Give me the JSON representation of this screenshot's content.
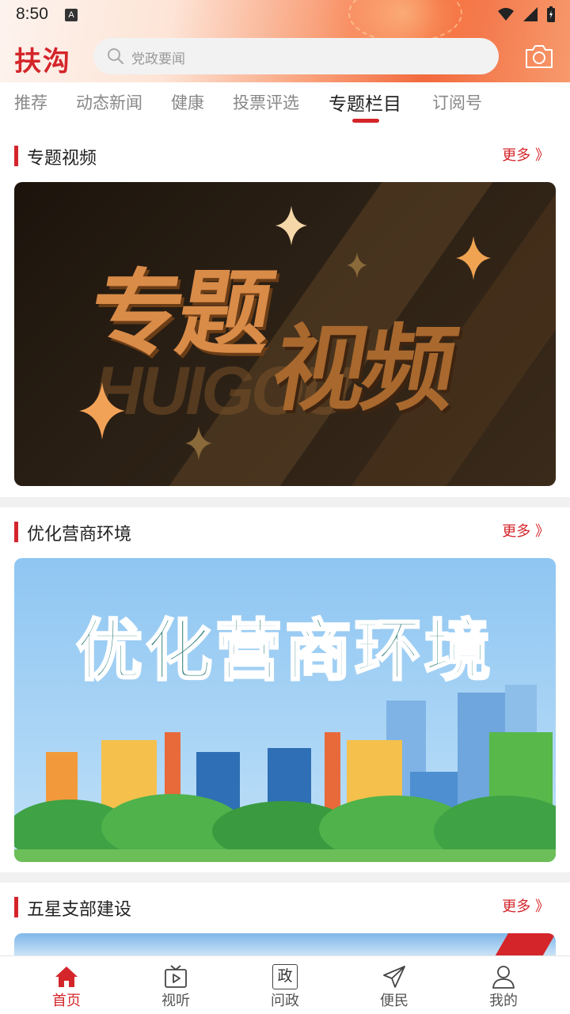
{
  "status_bar": {
    "time": "8:50",
    "indicator": "A"
  },
  "app": {
    "logo_text": "扶沟"
  },
  "search": {
    "placeholder": "党政要闻"
  },
  "tabs": [
    {
      "label": "推荐",
      "active": false
    },
    {
      "label": "动态新闻",
      "active": false
    },
    {
      "label": "健康",
      "active": false
    },
    {
      "label": "投票评选",
      "active": false
    },
    {
      "label": "专题栏目",
      "active": true
    },
    {
      "label": "订阅号",
      "active": false
    }
  ],
  "sections": [
    {
      "title": "专题视频",
      "more": "更多 》",
      "banner_text_1": "专题",
      "banner_text_2": "视频",
      "banner_ghost": "HUIGOU"
    },
    {
      "title": "优化营商环境",
      "more": "更多 》",
      "banner_text": "优化营商环境"
    },
    {
      "title": "五星支部建设",
      "more": "更多 》"
    }
  ],
  "bottom_nav": [
    {
      "label": "首页",
      "icon": "home-icon",
      "active": true
    },
    {
      "label": "视听",
      "icon": "tv-icon",
      "active": false
    },
    {
      "label": "问政",
      "icon": "zheng-icon",
      "icon_text": "政",
      "active": false
    },
    {
      "label": "便民",
      "icon": "send-icon",
      "active": false
    },
    {
      "label": "我的",
      "icon": "user-icon",
      "active": false
    }
  ],
  "colors": {
    "accent": "#d4252a",
    "section_bar": "#d4252a"
  }
}
